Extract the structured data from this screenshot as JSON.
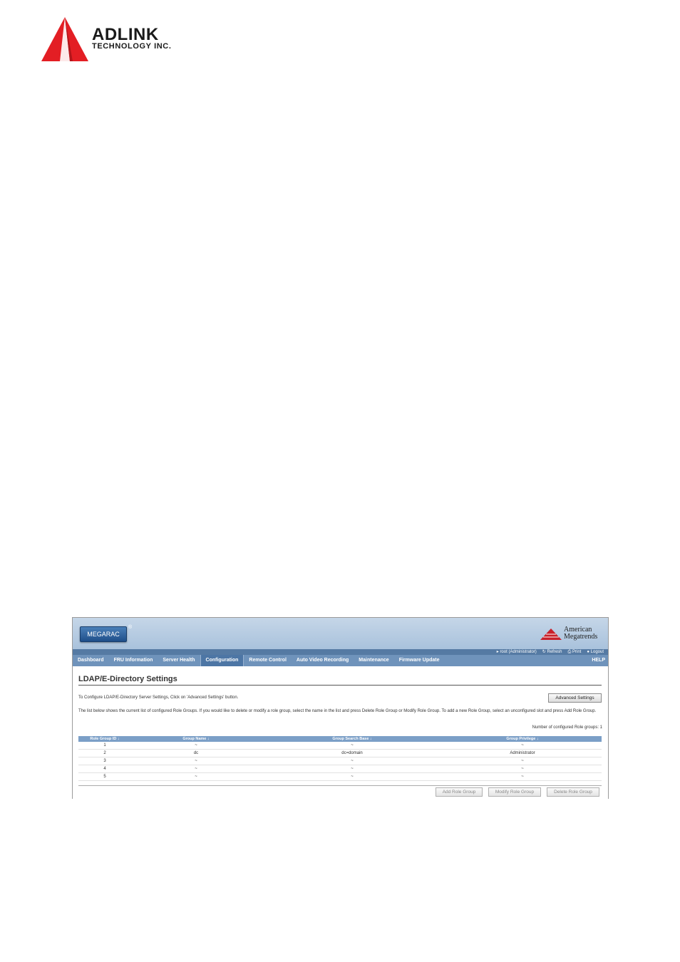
{
  "document": {
    "logo_name": "ADLINK",
    "logo_subtitle": "TECHNOLOGY INC.",
    "logo_color": "#e31e24"
  },
  "banner": {
    "product_label": "MEGARAC",
    "registered_mark": "®",
    "vendor_line1": "American",
    "vendor_line2": "Megatrends"
  },
  "toolbar": {
    "user": "root (Administrator)",
    "refresh": "Refresh",
    "print": "Print",
    "logout": "Logout"
  },
  "nav": {
    "tabs": [
      {
        "label": "Dashboard"
      },
      {
        "label": "FRU Information"
      },
      {
        "label": "Server Health"
      },
      {
        "label": "Configuration"
      },
      {
        "label": "Remote Control"
      },
      {
        "label": "Auto Video Recording"
      },
      {
        "label": "Maintenance"
      },
      {
        "label": "Firmware Update"
      }
    ],
    "active_tab": "Configuration",
    "help": "HELP"
  },
  "page": {
    "title": "LDAP/E-Directory Settings",
    "intro": "To Configure LDAP/E-Directory Server Settings, Click on 'Advanced Settings' button.",
    "advanced_button": "Advanced Settings",
    "description": "The list below shows the current list of configured Role Groups. If you would like to delete or modify a role group, select the name in the list and press Delete Role Group or Modify Role Group. To add a new Role Group, select an unconfigured slot and press Add Role Group.",
    "count": "Number of configured Role groups: 1"
  },
  "table": {
    "columns": [
      "Role Group ID  ↓",
      "Group Name  ↓",
      "Group Search Base  ↓",
      "Group Privilege  ↓"
    ],
    "rows": [
      [
        "1",
        "~",
        "~",
        "~"
      ],
      [
        "2",
        "dc",
        "dc=domain",
        "Administrator"
      ],
      [
        "3",
        "~",
        "~",
        "~"
      ],
      [
        "4",
        "~",
        "~",
        "~"
      ],
      [
        "5",
        "~",
        "~",
        "~"
      ]
    ]
  },
  "actions": {
    "add": "Add Role Group",
    "modify": "Modify Role Group",
    "delete": "Delete Role Group"
  }
}
